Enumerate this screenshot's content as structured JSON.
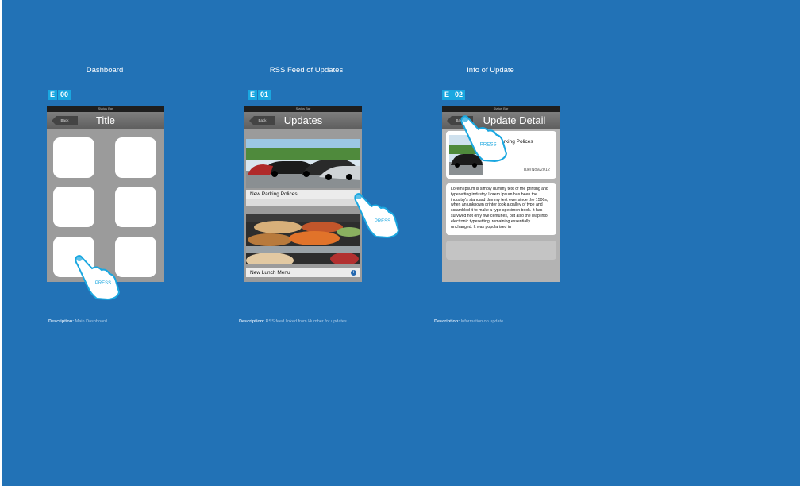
{
  "columns": [
    {
      "title": "Dashboard",
      "badge_letter": "E",
      "badge_number": "00",
      "status_bar": "Status Bar",
      "back_label": "Back",
      "nav_title": "Title",
      "description_label": "Description:",
      "description_text": "Main Dashboard",
      "press_label": "PRESS"
    },
    {
      "title": "RSS Feed of Updates",
      "badge_letter": "E",
      "badge_number": "01",
      "status_bar": "Status Bar",
      "back_label": "Back",
      "nav_title": "Updates",
      "items": [
        {
          "label": "New Parking Polices"
        },
        {
          "label": "New Lunch Menu"
        }
      ],
      "description_label": "Description:",
      "description_text": "RSS feed linked from Humber for updates.",
      "press_label": "PRESS"
    },
    {
      "title": "Info of Update",
      "badge_letter": "E",
      "badge_number": "02",
      "status_bar": "Status Bar",
      "back_label": "Back",
      "nav_title": "Update Detail",
      "headline": "New Parking Polices",
      "date": "Tue/Nov/2012",
      "body": "Lorem Ipsum is simply dummy text of the printing and typesetting industry. Lorem Ipsum has been the industry's standard dummy text ever since the 1500s, when an unknown printer took a galley of type and scrambled it to make a type specimen book. It has survived not only five centuries, but also the leap into electronic typesetting, remaining essentially unchanged. It was popularised in",
      "description_label": "Description:",
      "description_text": "Information on update.",
      "press_label": "PRESS"
    }
  ],
  "colors": {
    "background": "#2272b6",
    "badge": "#1aa7e0",
    "phone_body": "#9b9b9b"
  }
}
